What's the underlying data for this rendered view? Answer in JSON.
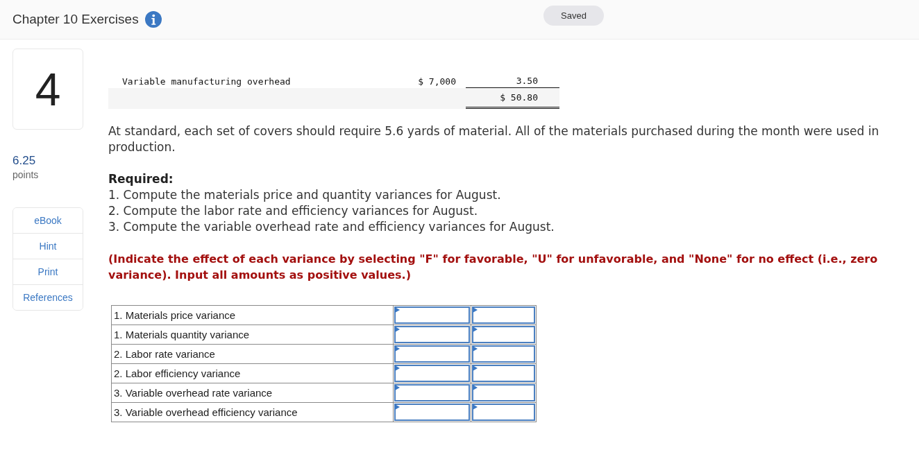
{
  "header": {
    "title": "Chapter 10 Exercises",
    "status": "Saved"
  },
  "sidebar": {
    "question_number": "4",
    "points": {
      "value": "6.25",
      "label": "points"
    },
    "tools": [
      "eBook",
      "Hint",
      "Print",
      "References"
    ]
  },
  "cost_table": {
    "rows": [
      {
        "kind": "line",
        "label": "Variable manufacturing overhead",
        "column_2": "$ 7,000",
        "column_3": "3.50"
      },
      {
        "kind": "total",
        "column_3": "$ 50.80"
      }
    ]
  },
  "problem_text": "At standard, each set of covers should require 5.6 yards of material. All of the materials purchased during the month were used in production.",
  "required": {
    "heading": "Required:",
    "items": [
      "1. Compute the materials price and quantity variances for August.",
      "2. Compute the labor rate and efficiency variances for August.",
      "3. Compute the variable overhead rate and efficiency variances for August."
    ]
  },
  "instructions": "(Indicate the effect of each variance by selecting \"F\" for favorable, \"U\" for unfavorable, and \"None\" for no effect (i.e., zero variance). Input all amounts as positive values.)",
  "variance_table": {
    "rows": [
      {
        "label": "1. Materials price variance"
      },
      {
        "label": "1. Materials quantity variance"
      },
      {
        "label": "2. Labor rate variance"
      },
      {
        "label": "2. Labor efficiency variance"
      },
      {
        "label": "3. Variable overhead rate variance"
      },
      {
        "label": "3. Variable overhead efficiency variance"
      }
    ]
  }
}
